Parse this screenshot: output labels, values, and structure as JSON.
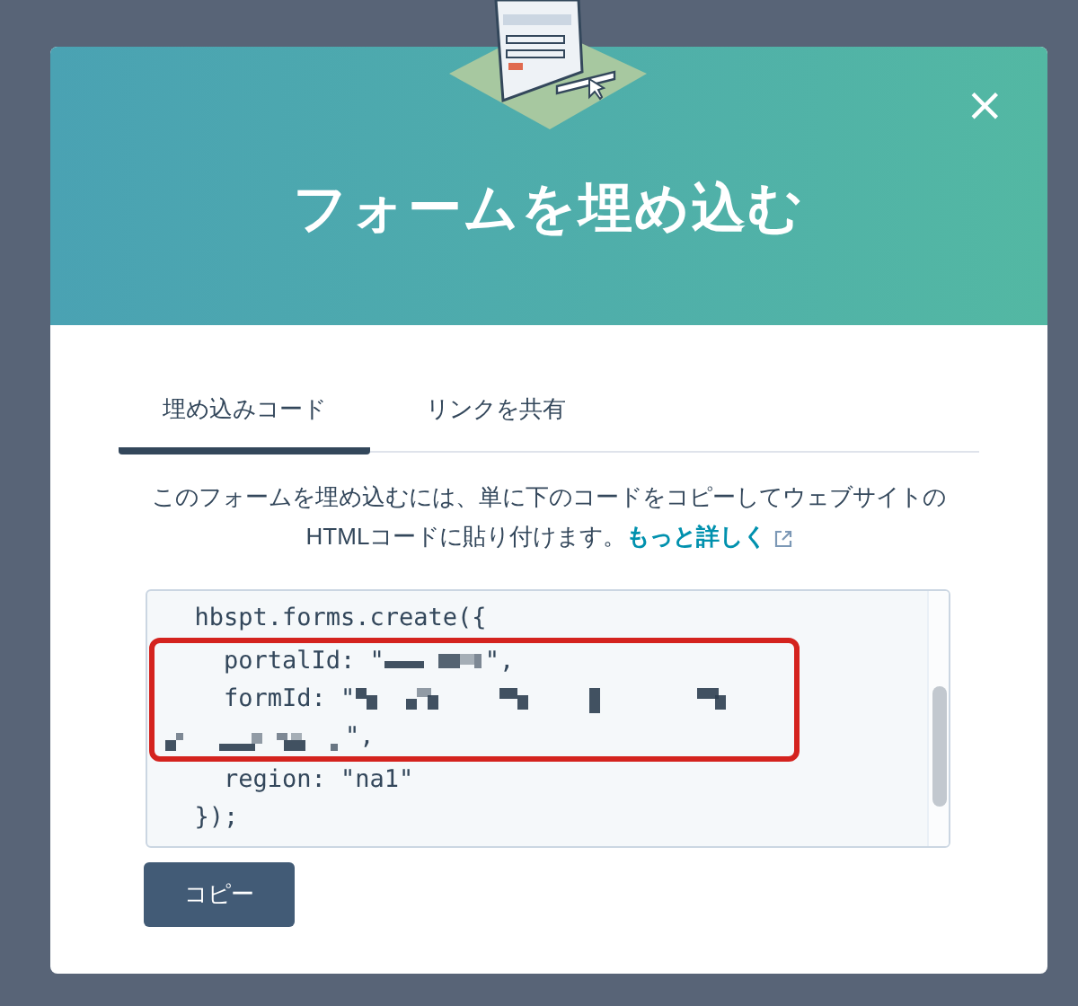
{
  "dialog": {
    "title": "フォームを埋め込む",
    "close": "×"
  },
  "tabs": [
    {
      "label": "埋め込みコード",
      "selected": true
    },
    {
      "label": "リンクを共有",
      "selected": false
    }
  ],
  "description": {
    "text": "このフォームを埋め込むには、単に下のコードをコピーしてウェブサイトのHTMLコードに貼り付けます。",
    "link": "もっと詳しく"
  },
  "code": {
    "lines_before": [
      {
        "parts": [
          {
            "kind": "code",
            "text": "  hbspt.forms.create({"
          }
        ]
      }
    ],
    "highlighted_lines": [
      {
        "parts": [
          {
            "kind": "code",
            "text": "    portalId: \""
          },
          {
            "kind": "redacted"
          },
          {
            "kind": "code",
            "text": "\","
          }
        ]
      },
      {
        "parts": [
          {
            "kind": "code",
            "text": "    formId: \""
          },
          {
            "kind": "redacted"
          }
        ]
      },
      {
        "parts": [
          {
            "kind": "redacted"
          },
          {
            "kind": "code",
            "text": "\","
          }
        ]
      }
    ],
    "lines_after": [
      {
        "parts": [
          {
            "kind": "code",
            "text": "    region: \"na1\""
          }
        ]
      },
      {
        "parts": [
          {
            "kind": "code",
            "text": "  });"
          }
        ]
      }
    ]
  },
  "copy_button": "コピー"
}
